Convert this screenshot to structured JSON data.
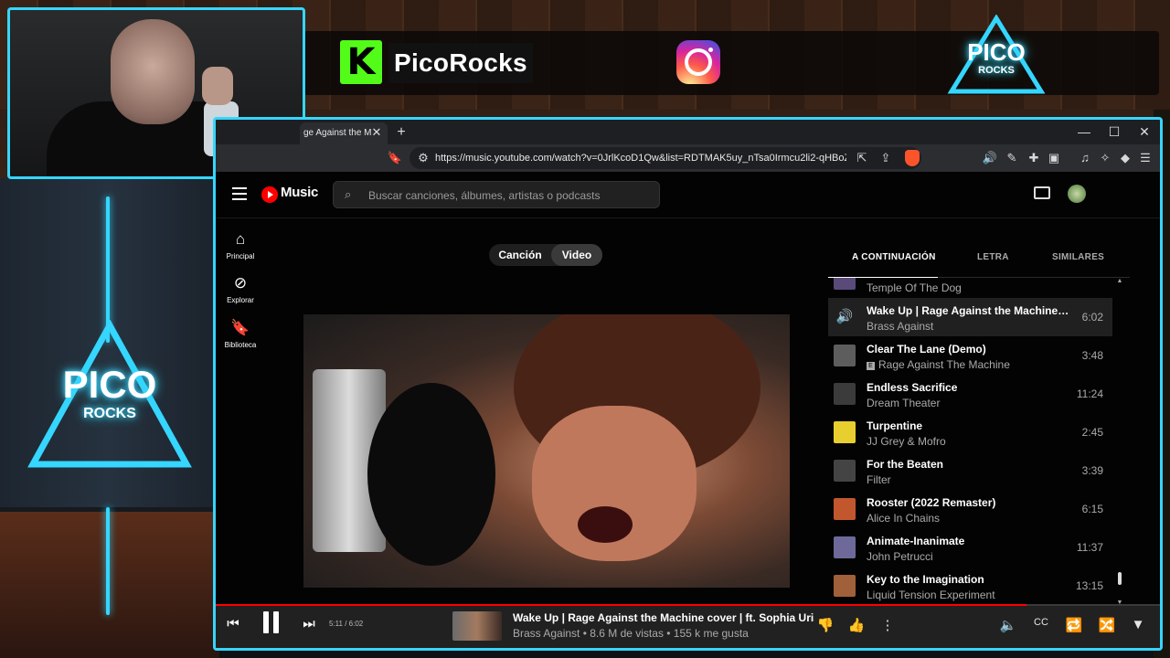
{
  "overlay": {
    "kick_letter": "K",
    "channel_name": "PicoRocks",
    "logo_lines": [
      "PICO",
      "ROCKS"
    ]
  },
  "browser": {
    "tab_title": "ge Against the M",
    "url": "https://music.youtube.com/watch?v=0JrlKcoD1Qw&list=RDTMAK5uy_nTsa0Irmcu2li2-qHBoZxtr..."
  },
  "ytm": {
    "brand": "Music",
    "search_placeholder": "Buscar canciones, álbumes, artistas o podcasts",
    "sidebar": [
      {
        "label": "Principal",
        "icon": "home-icon"
      },
      {
        "label": "Explorar",
        "icon": "compass-icon"
      },
      {
        "label": "Biblioteca",
        "icon": "library-icon"
      }
    ],
    "toggle": {
      "song": "Canción",
      "video": "Video",
      "selected": "Video"
    },
    "queue_tabs": {
      "next": "A CONTINUACIÓN",
      "lyrics": "LETRA",
      "related": "SIMILARES"
    },
    "queue": [
      {
        "title": "",
        "artist": "Temple Of The Dog",
        "duration": "",
        "thumb_color": "#5a4a7a"
      },
      {
        "title": "Wake Up | Rage Against the Machine co...",
        "artist": "Brass Against",
        "duration": "6:02",
        "current": true,
        "thumb_color": "#202020"
      },
      {
        "title": "Clear The Lane (Demo)",
        "artist": "Rage Against The Machine",
        "duration": "3:48",
        "explicit": true,
        "thumb_color": "#5d5d5d"
      },
      {
        "title": "Endless Sacrifice",
        "artist": "Dream Theater",
        "duration": "11:24",
        "thumb_color": "#3b3b3b"
      },
      {
        "title": "Turpentine",
        "artist": "JJ Grey & Mofro",
        "duration": "2:45",
        "thumb_color": "#e8cf2f"
      },
      {
        "title": "For the Beaten",
        "artist": "Filter",
        "duration": "3:39",
        "thumb_color": "#444"
      },
      {
        "title": "Rooster (2022 Remaster)",
        "artist": "Alice In Chains",
        "duration": "6:15",
        "thumb_color": "#c2572e"
      },
      {
        "title": "Animate-Inanimate",
        "artist": "John Petrucci",
        "duration": "11:37",
        "thumb_color": "#6d6a99"
      },
      {
        "title": "Key to the Imagination",
        "artist": "Liquid Tension Experiment",
        "duration": "13:15",
        "thumb_color": "#a0603a"
      }
    ],
    "player": {
      "time": "5:11 / 6:02",
      "progress": 0.859,
      "title": "Wake Up | Rage Against the Machine cover | ft. Sophia Urista",
      "subtitle": "Brass Against • 8.6 M de vistas • 155 k me gusta"
    }
  },
  "colors": {
    "neon": "#35d6ff",
    "yt_red": "#ff0000",
    "kick_green": "#53fc18"
  }
}
